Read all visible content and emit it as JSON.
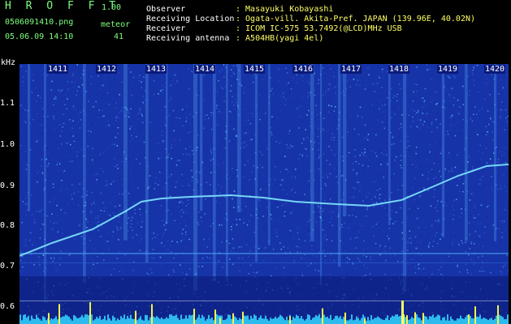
{
  "app": {
    "brand": "H R O F F T",
    "version": "1.00",
    "filename": "0506091410.png",
    "datetime": "05.06.09 14:10",
    "meteor_label": "meteor",
    "meteor_count": "41"
  },
  "info": {
    "observer_label": "Observer",
    "observer_value": ": Masayuki Kobayashi",
    "location_label": "Receiving Location",
    "location_value": ": Ogata-vill. Akita-Pref. JAPAN (139.96E, 40.02N)",
    "receiver_label": "Receiver",
    "receiver_value": ": ICOM IC-575 53.7492(@LCD)MHz USB",
    "antenna_label": "Receiving antenna",
    "antenna_value": ": A504HB(yagi 4el)"
  },
  "axis": {
    "unit": "kHz",
    "y_ticks": [
      "1.1",
      "1.0",
      "0.9",
      "0.8",
      "0.7",
      "0.6"
    ],
    "x_ticks": [
      "1411",
      "1412",
      "1413",
      "1414",
      "1415",
      "1416",
      "1417",
      "1418",
      "1419",
      "1420"
    ]
  },
  "colors": {
    "background": "#000000",
    "spectrogram_bg": "#1733a8",
    "trace": "#7fe8ff",
    "header_green": "#7cff7c",
    "header_yellow": "#ffff66"
  }
}
